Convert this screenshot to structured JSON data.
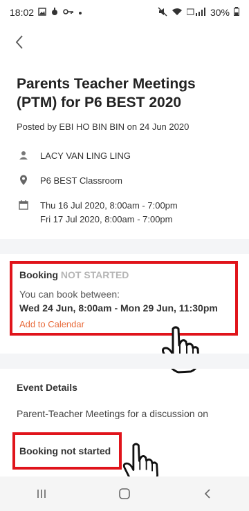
{
  "status_bar": {
    "time": "18:02",
    "battery": "30%"
  },
  "event": {
    "title": "Parents Teacher Meetings (PTM) for P6 BEST 2020",
    "posted": "Posted by EBI HO BIN BIN on 24 Jun 2020",
    "teacher": "LACY VAN LING LING",
    "location": "P6 BEST Classroom",
    "dates": [
      "Thu 16 Jul 2020, 8:00am - 7:00pm",
      "Fri 17 Jul 2020, 8:00am - 7:00pm"
    ]
  },
  "booking": {
    "label": "Booking",
    "status": "NOT STARTED",
    "sub": "You can book between:",
    "range": "Wed 24 Jun, 8:00am - Mon 29 Jun, 11:30pm",
    "add_calendar": "Add to Calendar"
  },
  "details": {
    "title": "Event Details",
    "description": "Parent-Teacher Meetings for a discussion on"
  },
  "footer_status": "Booking not started",
  "icons": {
    "back": "chevron-left-icon",
    "person": "person-icon",
    "location": "location-pin-icon",
    "calendar": "calendar-icon",
    "hand": "hand-pointer-icon",
    "nav_recent": "recent-apps-icon",
    "nav_home": "home-icon",
    "nav_back": "back-icon"
  },
  "colors": {
    "highlight": "#e0141b",
    "link": "#e86a3a",
    "muted": "#b5b5b5"
  }
}
